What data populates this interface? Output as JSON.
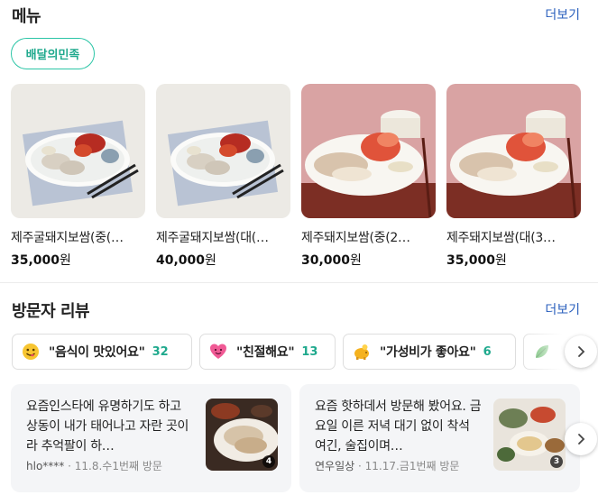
{
  "menu_section": {
    "title": "메뉴",
    "more": "더보기",
    "delivery_chip": "배달의민족",
    "items": [
      {
        "name": "제주굴돼지보쌈(중(…",
        "price": "35,000",
        "unit": "원"
      },
      {
        "name": "제주굴돼지보쌈(대(…",
        "price": "40,000",
        "unit": "원"
      },
      {
        "name": "제주돼지보쌈(중(2…",
        "price": "30,000",
        "unit": "원"
      },
      {
        "name": "제주돼지보쌈(대(3…",
        "price": "35,000",
        "unit": "원"
      }
    ]
  },
  "review_section": {
    "title": "방문자 리뷰",
    "more": "더보기",
    "keywords": [
      {
        "icon": "yum-face-icon",
        "text": "\"음식이 맛있어요\"",
        "count": "32"
      },
      {
        "icon": "heart-face-icon",
        "text": "\"친절해요\"",
        "count": "13"
      },
      {
        "icon": "piggy-bank-icon",
        "text": "\"가성비가 좋아요\"",
        "count": "6"
      },
      {
        "icon": "leaf-icon",
        "text": "\"",
        "count": ""
      }
    ],
    "reviews": [
      {
        "text": "요즘인스타에 유명하기도 하고 상동이 내가 태어나고 자란 곳이라 추억팔이 하…",
        "author": "hlo****",
        "date": "11.8.수",
        "visit": "1번째 방문",
        "photo_count": "4"
      },
      {
        "text": "요즘 핫하데서 방문해 봤어요. 금요일 이른 저녁 대기 없이 착석 여긴, 술집이며…",
        "author": "연우일상",
        "date": "11.17.금",
        "visit": "1번째 방문",
        "photo_count": "3"
      }
    ]
  },
  "colors": {
    "accent_green": "#1fa98d",
    "link_blue": "#2a5fbd",
    "card_bg": "#f4f5f7"
  }
}
